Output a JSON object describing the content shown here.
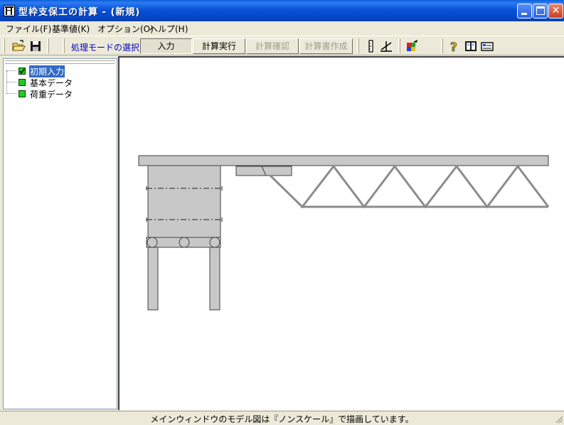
{
  "window": {
    "title": "型枠支保工の計算 - (新規)",
    "buttons": [
      "minimize",
      "maximize",
      "close"
    ]
  },
  "menu": {
    "items": [
      {
        "label": "ファイル(F)"
      },
      {
        "label": "基準値(K)"
      },
      {
        "label": "オプション(O)"
      },
      {
        "label": "ヘルプ(H)"
      }
    ]
  },
  "toolbar": {
    "mode_label": "処理モードの選択",
    "modes": [
      {
        "label": "入力",
        "state": "pressed"
      },
      {
        "label": "計算実行",
        "state": "enabled"
      },
      {
        "label": "計算確認",
        "state": "disabled"
      },
      {
        "label": "計算書作成",
        "state": "disabled"
      }
    ],
    "icons": [
      "open-folder-icon",
      "save-disk-icon",
      "ruler-icon",
      "draw-measure-icon",
      "color-settings-icon",
      "help-icon",
      "manual-book-icon",
      "version-info-icon"
    ]
  },
  "tree": {
    "items": [
      {
        "label": "初期入力",
        "selected": true,
        "checked": true
      },
      {
        "label": "基本データ",
        "selected": false,
        "checked": false
      },
      {
        "label": "荷重データ",
        "selected": false,
        "checked": false
      }
    ]
  },
  "colors": {
    "title_bar": "#0A5FD9",
    "tree_status": "#22CC22",
    "selection": "#316AC5",
    "mode_label": "#0000C0",
    "model_fill": "#C8C8C8",
    "truss": "#8C8C8C"
  },
  "status": {
    "text": "メインウィンドウのモデル図は『ノンスケール』で描画しています。"
  }
}
